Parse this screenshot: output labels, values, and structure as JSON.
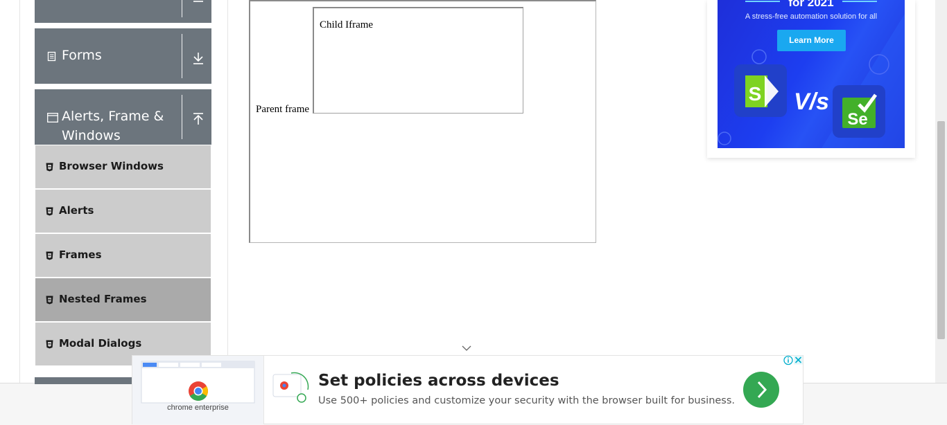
{
  "sidebar": {
    "groups": [
      {
        "label": "Forms",
        "icon": "form-icon",
        "toggle": "download-arrow-icon"
      },
      {
        "label": "Alerts, Frame & Windows",
        "label_line1": "Alerts, Frame &",
        "label_line2": "Windows",
        "icon": "window-icon",
        "toggle": "upload-arrow-icon"
      }
    ],
    "items": [
      {
        "label": "Browser Windows",
        "active": false
      },
      {
        "label": "Alerts",
        "active": false
      },
      {
        "label": "Frames",
        "active": false
      },
      {
        "label": "Nested Frames",
        "active": true
      },
      {
        "label": "Modal Dialogs",
        "active": false
      }
    ]
  },
  "main": {
    "parent_frame_text": "Parent frame",
    "child_frame_text": "Child Iframe"
  },
  "right_ad": {
    "headline_fragment": "for 2021",
    "subtitle": "A stress-free automation solution for all",
    "button": "Learn More",
    "vs_text": "V/s"
  },
  "bottom_ad": {
    "title": "Set policies across devices",
    "description": "Use 500+ policies and customize your security with the browser built for business.",
    "brand_label": "chrome enterprise"
  },
  "colors": {
    "group_bg": "#6c757d",
    "item_bg": "#cccccc",
    "item_active_bg": "#aaaaaa",
    "ad_blue": "#1d3ef0",
    "ad_button": "#1aa8f0",
    "go_green": "#34a853"
  }
}
